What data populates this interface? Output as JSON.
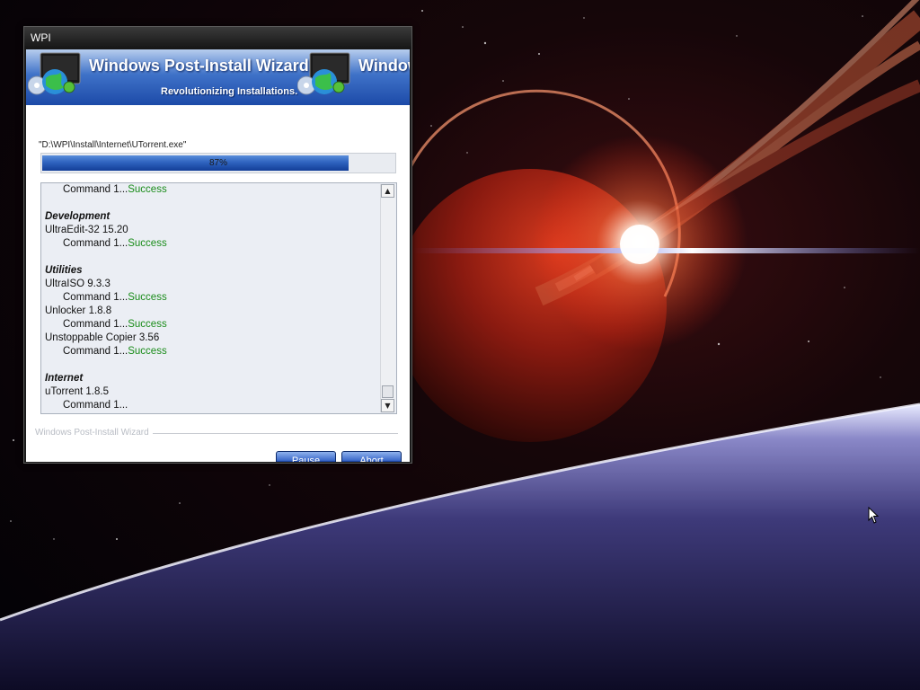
{
  "window": {
    "title": "WPI"
  },
  "banner": {
    "title": "Windows Post-Install Wizard",
    "title_repeat": "Windows Post-Install Wizard",
    "subtitle": "Revolutionizing Installations."
  },
  "status": {
    "current_file": "\"D:\\WPI\\Install\\Internet\\UTorrent.exe\"",
    "progress_percent": 87,
    "progress_label": "87%"
  },
  "log": {
    "lines": [
      {
        "type": "command",
        "text": "Command 1...",
        "status": "Success"
      },
      {
        "type": "blank",
        "text": ""
      },
      {
        "type": "header",
        "text": "Development"
      },
      {
        "type": "item",
        "text": "UltraEdit-32 15.20"
      },
      {
        "type": "command",
        "text": "Command 1...",
        "status": "Success"
      },
      {
        "type": "blank",
        "text": ""
      },
      {
        "type": "header",
        "text": "Utilities"
      },
      {
        "type": "item",
        "text": "UltraISO 9.3.3"
      },
      {
        "type": "command",
        "text": "Command 1...",
        "status": "Success"
      },
      {
        "type": "item",
        "text": "Unlocker 1.8.8"
      },
      {
        "type": "command",
        "text": "Command 1...",
        "status": "Success"
      },
      {
        "type": "item",
        "text": "Unstoppable Copier 3.56"
      },
      {
        "type": "command",
        "text": "Command 1...",
        "status": "Success"
      },
      {
        "type": "blank",
        "text": ""
      },
      {
        "type": "header",
        "text": "Internet"
      },
      {
        "type": "item",
        "text": "uTorrent 1.8.5"
      },
      {
        "type": "command",
        "text": "Command 1...",
        "status": ""
      }
    ],
    "scroll_position_fraction": 0.97
  },
  "footer": {
    "group_label": "Windows Post-Install Wizard",
    "pause_label": "Pause",
    "abort_label": "Abort"
  },
  "colors": {
    "success": "#1a8c1a",
    "progress_fill": "#2f63bf",
    "button": "#2c5bbd"
  },
  "icons": {
    "logo": "monitor-globe-logo-icon",
    "scroll_up": "arrow-up-icon",
    "scroll_down": "arrow-down-icon",
    "cursor": "mouse-cursor-icon"
  }
}
